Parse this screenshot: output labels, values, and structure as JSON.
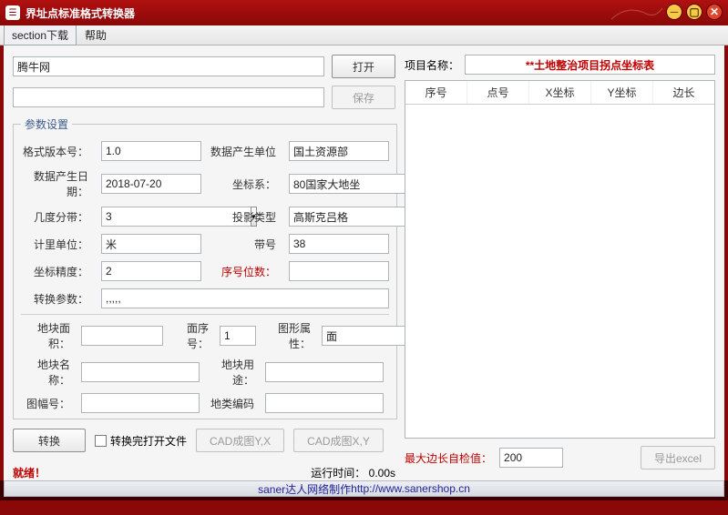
{
  "window": {
    "title": "界址点标准格式转换器"
  },
  "menu": {
    "section": "section下载",
    "help": "帮助"
  },
  "toolbar": {
    "path_value": "腾牛网",
    "open": "打开",
    "save": "保存"
  },
  "params": {
    "legend": "参数设置",
    "version_lbl": "格式版本号：",
    "version": "1.0",
    "unit_gen_lbl": "数据产生单位",
    "unit_gen": "国土资源部",
    "date_lbl": "数据产生日期：",
    "date": "2018-07-20",
    "coordsys_lbl": "坐标系：",
    "coordsys": "80国家大地坐",
    "zone_lbl": "几度分带：",
    "zone": "3",
    "proj_lbl": "投影类型",
    "proj": "高斯克吕格",
    "meas_lbl": "计里单位：",
    "meas": "米",
    "band_lbl": "带号",
    "band": "38",
    "prec_lbl": "坐标精度：",
    "prec": "2",
    "seq_lbl": "序号位数：",
    "seq": "",
    "convparam_lbl": "转换参数：",
    "convparam": ",,,,,",
    "area_lbl": "地块面积：",
    "area": "",
    "faceno_lbl": "面序号：",
    "faceno": "1",
    "shape_lbl": "图形属性：",
    "shape": "面",
    "blockname_lbl": "地块名称：",
    "blockname": "",
    "landuse_lbl": "地块用途：",
    "landuse": "",
    "sheet_lbl": "图幅号：",
    "sheet": "",
    "landcode_lbl": "地类编码",
    "landcode": ""
  },
  "actions": {
    "convert": "转换",
    "openafter": "转换完打开文件",
    "cadyx": "CAD成图Y,X",
    "cadxy": "CAD成图X,Y"
  },
  "statusbar": {
    "ready": "就绪！",
    "runtime_lbl": "运行时间：",
    "runtime": "0.00s"
  },
  "right": {
    "projname_lbl": "项目名称：",
    "projtitle": "**土地整治项目拐点坐标表",
    "cols": [
      "序号",
      "点号",
      "X坐标",
      "Y坐标",
      "边长"
    ],
    "maxedge_lbl": "最大边长自检值：",
    "maxedge": "200",
    "export": "导出excel"
  },
  "footer": {
    "text": "saner达人网络制作 http://www.sanershop.cn",
    "url": "http://www.sanershop.cn",
    "prefix": "saner达人网络制作 "
  }
}
